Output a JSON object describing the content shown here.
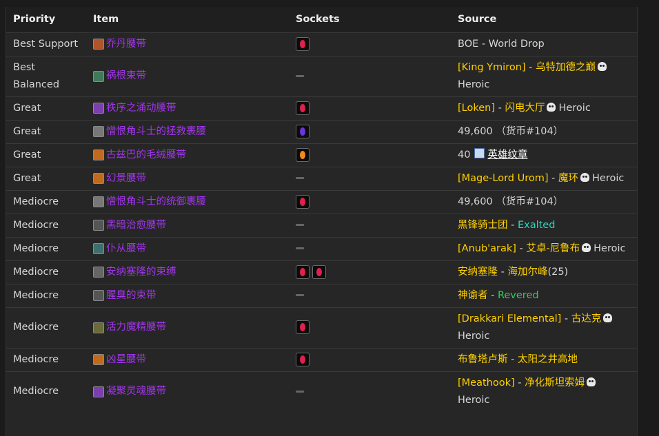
{
  "headers": {
    "priority": "Priority",
    "item": "Item",
    "sockets": "Sockets",
    "source": "Source"
  },
  "heroic": "Heroic",
  "rows": [
    {
      "priority": "Best Support",
      "item": "乔丹腰带",
      "sockets": [
        "red"
      ],
      "source": {
        "place": "BOE - World Drop"
      }
    },
    {
      "priority": "Best Balanced",
      "item": "祸根束带",
      "sockets": [],
      "source": {
        "boss": "[King Ymiron]",
        "sep": " - ",
        "place": "乌特加德之巅",
        "heroic": true
      }
    },
    {
      "priority": "Great",
      "item": "秩序之涌动腰带",
      "sockets": [
        "red"
      ],
      "source": {
        "boss": "[Loken]",
        "sep": " - ",
        "place": "闪电大厅",
        "heroic": true
      }
    },
    {
      "priority": "Great",
      "item": "憎恨角斗士的拯救裹腰",
      "sockets": [
        "prismatic"
      ],
      "source": {
        "cost": "49,600 （货币#104）"
      }
    },
    {
      "priority": "Great",
      "item": "古兹巴的毛绒腰带",
      "sockets": [
        "orange"
      ],
      "source": {
        "amount": "40",
        "currency": "英雄纹章"
      }
    },
    {
      "priority": "Great",
      "item": "幻景腰带",
      "sockets": [],
      "source": {
        "boss": "[Mage-Lord Urom]",
        "sep": " - ",
        "place": "魔环",
        "heroic": true
      }
    },
    {
      "priority": "Mediocre",
      "item": "憎恨角斗士的统御裹腰",
      "sockets": [
        "red"
      ],
      "source": {
        "cost": "49,600 （货币#104）"
      }
    },
    {
      "priority": "Mediocre",
      "item": "黑暗治愈腰带",
      "sockets": [],
      "source": {
        "faction": "黑锋骑士团",
        "sep": " - ",
        "standing": "Exalted"
      }
    },
    {
      "priority": "Mediocre",
      "item": "仆从腰带",
      "sockets": [],
      "source": {
        "boss": "[Anub'arak]",
        "sep": " - ",
        "place": "艾卓-尼鲁布",
        "heroic": true
      }
    },
    {
      "priority": "Mediocre",
      "item": "安纳塞隆的束缚",
      "sockets": [
        "red",
        "red"
      ],
      "source": {
        "boss": "安纳塞隆",
        "sep": " - ",
        "place": "海加尔峰",
        "level": "(25)"
      }
    },
    {
      "priority": "Mediocre",
      "item": "腥臭的束带",
      "sockets": [],
      "source": {
        "faction": "神谕者",
        "sep": " - ",
        "standing": "Revered"
      }
    },
    {
      "priority": "Mediocre",
      "item": "活力魔精腰带",
      "sockets": [
        "red"
      ],
      "source": {
        "boss": "[Drakkari Elemental]",
        "sep": " - ",
        "place": "古达克",
        "heroic": true
      }
    },
    {
      "priority": "Mediocre",
      "item": "凶星腰带",
      "sockets": [
        "red"
      ],
      "source": {
        "boss": "布鲁塔卢斯",
        "sep": " - ",
        "place": "太阳之井高地"
      }
    },
    {
      "priority": "Mediocre",
      "item": "凝聚灵魂腰带",
      "sockets": [],
      "source": {
        "boss": "[Meathook]",
        "sep": " - ",
        "place": "净化斯坦索姆",
        "heroic": true
      }
    }
  ],
  "colors": {
    "epic": "#a335ee",
    "quest_gold": "#ffd100",
    "exalted": "#2ad6c3",
    "revered": "#2bd05f",
    "gem_red": "#e0204f",
    "gem_prismatic": "#6a35e0",
    "gem_orange": "#f08a1c"
  },
  "icons": [
    "belt-icon",
    "red-gem-socket-icon",
    "prismatic-gem-socket-icon",
    "orange-gem-socket-icon",
    "skull-heroic-icon",
    "badge-of-heroism-icon",
    "empty-socket-dash-icon"
  ]
}
